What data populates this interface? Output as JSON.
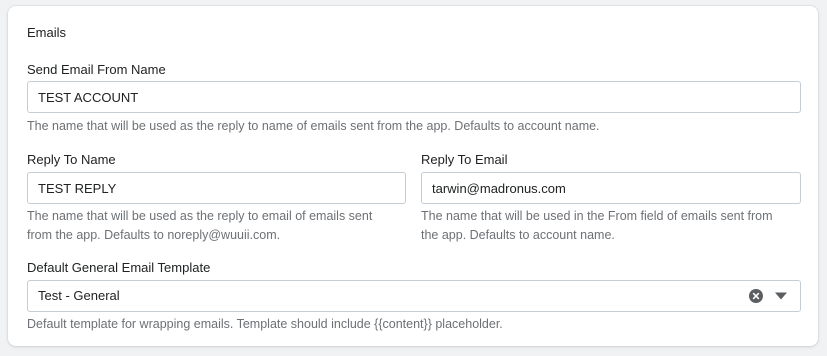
{
  "section": {
    "title": "Emails"
  },
  "send_from_name": {
    "label": "Send Email From Name",
    "value": "TEST ACCOUNT",
    "help": "The name that will be used as the reply to name of emails sent from the app. Defaults to account name."
  },
  "reply_to_name": {
    "label": "Reply To Name",
    "value": "TEST REPLY",
    "help_line1": "The name that will be used as the reply to email of emails sent",
    "help_line2": "from the app. Defaults to noreply@wuuii.com."
  },
  "reply_to_email": {
    "label": "Reply To Email",
    "value": "tarwin@madronus.com",
    "help_line1": "The name that will be used in the From field of emails sent from",
    "help_line2": "the app. Defaults to account name."
  },
  "template": {
    "label": "Default General Email Template",
    "selected": "Test - General",
    "help": "Default template for wrapping emails. Template should include {{content}} placeholder."
  },
  "icons": {
    "clear": "clear-circle-icon",
    "dropdown": "triangle-down-icon"
  },
  "colors": {
    "icon": "#5c5f62",
    "border": "#c4cdd5",
    "help_text": "#6d7175"
  }
}
